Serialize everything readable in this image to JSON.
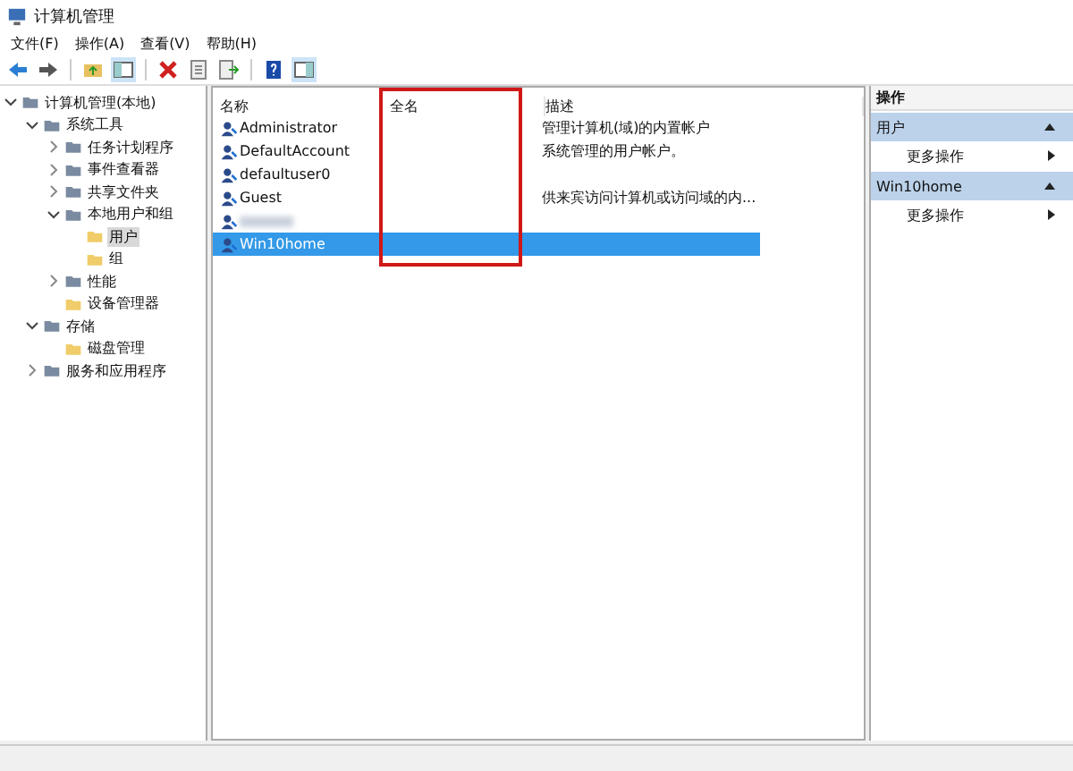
{
  "window": {
    "title": "计算机管理"
  },
  "menu": [
    "文件(F)",
    "操作(A)",
    "查看(V)",
    "帮助(H)"
  ],
  "tree": [
    {
      "label": "计算机管理(本地)",
      "expanded": true,
      "selected": false,
      "children": [
        {
          "label": "系统工具",
          "expanded": true,
          "selected": false,
          "children": [
            {
              "label": "任务计划程序",
              "expanded": false,
              "selected": false
            },
            {
              "label": "事件查看器",
              "expanded": false,
              "selected": false
            },
            {
              "label": "共享文件夹",
              "expanded": false,
              "selected": false
            },
            {
              "label": "本地用户和组",
              "expanded": true,
              "selected": false,
              "children": [
                {
                  "label": "用户",
                  "selected": true
                },
                {
                  "label": "组",
                  "selected": false
                }
              ]
            },
            {
              "label": "性能",
              "expanded": false,
              "selected": false
            },
            {
              "label": "设备管理器",
              "selected": false
            }
          ]
        },
        {
          "label": "存储",
          "expanded": true,
          "selected": false,
          "children": [
            {
              "label": "磁盘管理",
              "selected": false
            }
          ]
        },
        {
          "label": "服务和应用程序",
          "expanded": false,
          "selected": false
        }
      ]
    }
  ],
  "table": {
    "columns": [
      "名称",
      "全名",
      "描述"
    ],
    "rows": [
      {
        "kind": "user",
        "name": "Administrator",
        "description": "管理计算机(域)的内置帐户",
        "selected": false
      },
      {
        "kind": "user",
        "name": "DefaultAccount",
        "description": "系统管理的用户帐户。",
        "selected": false
      },
      {
        "kind": "user",
        "name": "defaultuser0",
        "selected": false
      },
      {
        "kind": "user",
        "name": "Guest",
        "description": "供来宾访问计算机或访问域的内...",
        "selected": false
      },
      {
        "kind": "blurred",
        "selected": false
      },
      {
        "kind": "user",
        "name": "Win10home",
        "selected": true
      }
    ]
  },
  "actions": {
    "title": "操作",
    "sections": [
      {
        "title": "用户",
        "items": [
          "更多操作"
        ]
      },
      {
        "title": "Win10home",
        "items": [
          "更多操作"
        ]
      }
    ]
  }
}
